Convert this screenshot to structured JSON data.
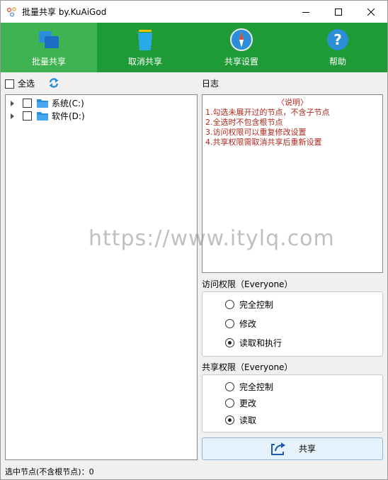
{
  "window": {
    "title": "批量共享 by.KuAiGod"
  },
  "toolbar": {
    "items": [
      {
        "label": "批量共享",
        "icon": "windows-icon",
        "active": true
      },
      {
        "label": "取消共享",
        "icon": "trash-icon",
        "active": false
      },
      {
        "label": "共享设置",
        "icon": "compass-icon",
        "active": false
      },
      {
        "label": "帮助",
        "icon": "help-icon",
        "active": false
      }
    ]
  },
  "select_all": {
    "label": "全选",
    "checked": false
  },
  "tree": {
    "nodes": [
      {
        "label": "系统(C:)",
        "checked": false
      },
      {
        "label": "软件(D:)",
        "checked": false
      }
    ]
  },
  "log": {
    "label": "日志",
    "heading": "〈说明〉",
    "lines": [
      "1.勾选未展开过的节点，不含子节点",
      "2.全选时不包含根节点",
      "3.访问权限可以重复修改设置",
      "4.共享权限需取消共享后重新设置"
    ]
  },
  "access_perm": {
    "label": "访问权限（Everyone）",
    "options": [
      "完全控制",
      "修改",
      "读取和执行"
    ],
    "selected_index": 2
  },
  "share_perm": {
    "label": "共享权限（Everyone）",
    "options": [
      "完全控制",
      "更改",
      "读取"
    ],
    "selected_index": 2
  },
  "share_button": {
    "label": "共享"
  },
  "status": {
    "text": "选中节点(不含根节点)：0"
  },
  "watermark": "https://www.itylq.com",
  "colors": {
    "toolbar_bg": "#1e9a36",
    "toolbar_active": "#3fb351",
    "log_text": "#b0281c"
  }
}
